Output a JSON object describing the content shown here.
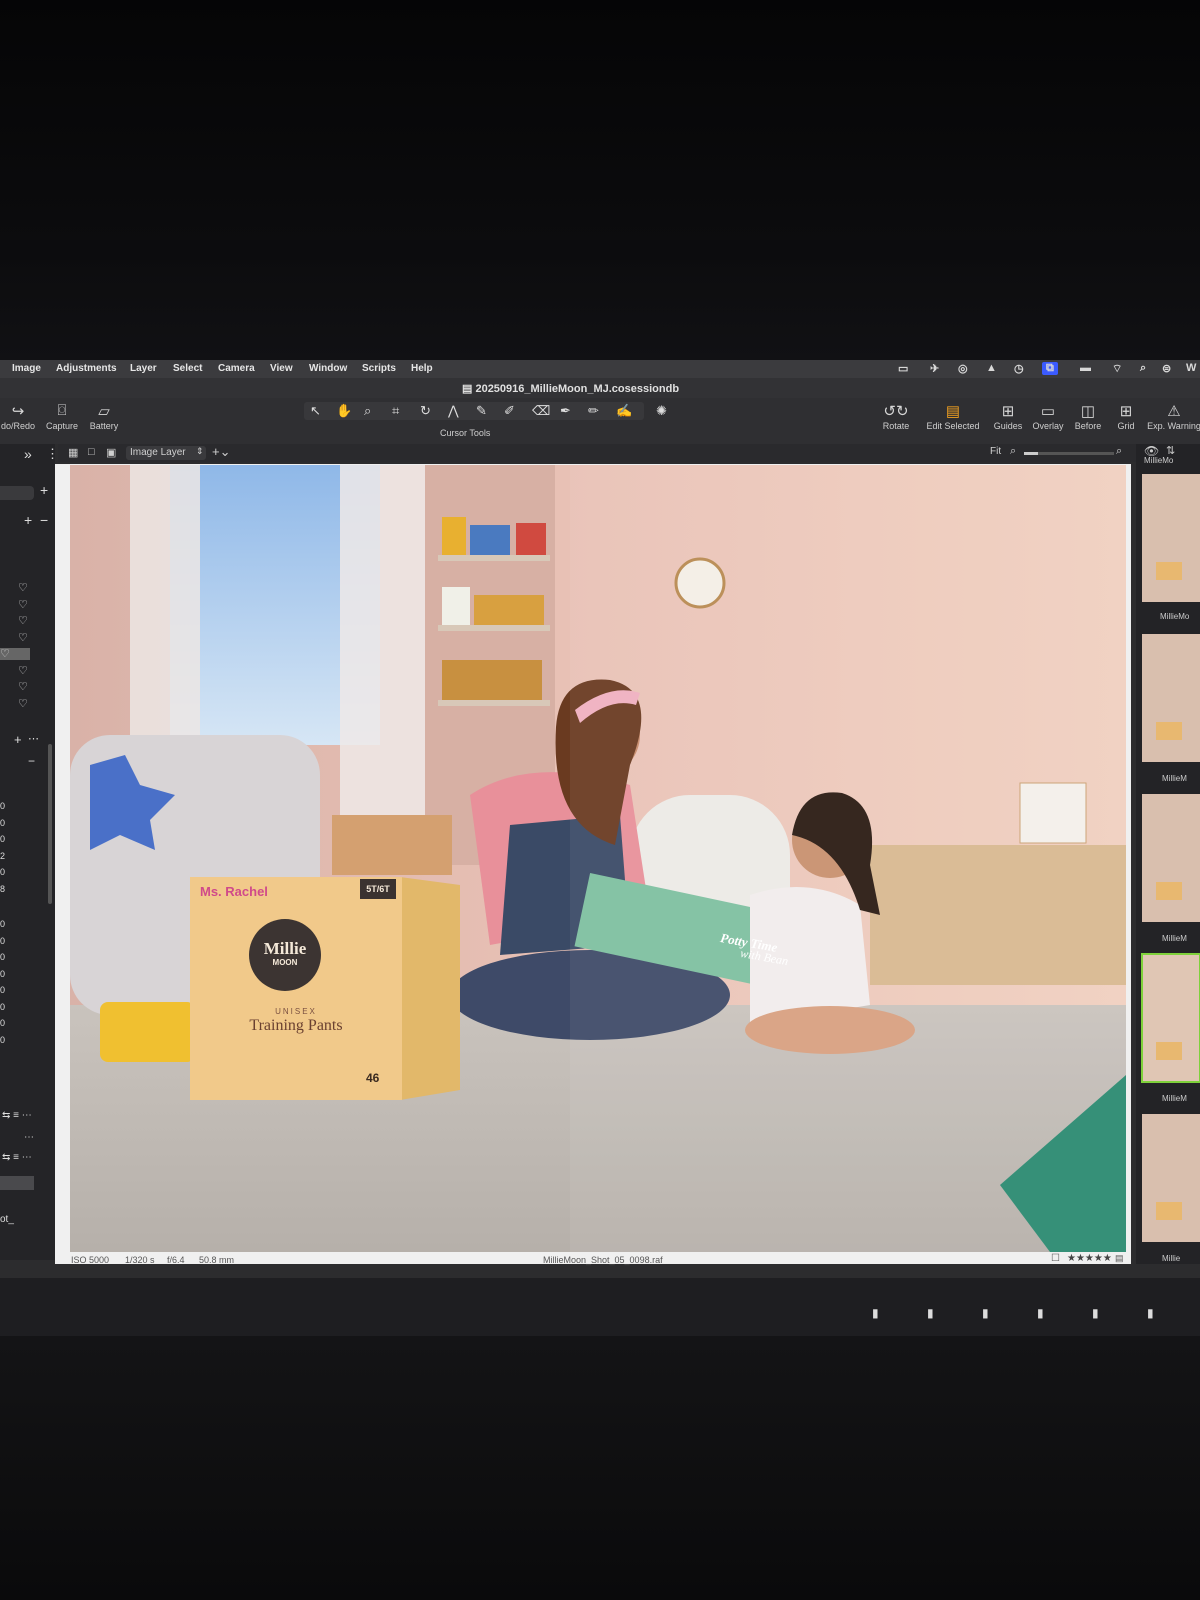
{
  "menubar": {
    "items": [
      "Image",
      "Adjustments",
      "Layer",
      "Select",
      "Camera",
      "View",
      "Window",
      "Scripts",
      "Help"
    ],
    "right_partial": "W"
  },
  "window_title": "20250916_MillieMoon_MJ.cosessiondb",
  "toolbar": {
    "undo_redo_label": "do/Redo",
    "capture_label": "Capture",
    "battery_label": "Battery",
    "cursor_tools_label": "Cursor Tools",
    "rotate_label": "Rotate",
    "edit_selected_label": "Edit Selected",
    "guides_label": "Guides",
    "overlay_label": "Overlay",
    "before_label": "Before",
    "grid_label": "Grid",
    "exp_warning_label": "Exp. Warning"
  },
  "viewer": {
    "layer_select": "Image Layer",
    "zoom_label": "Fit"
  },
  "left_panel": {
    "values": [
      "0",
      "0",
      "0",
      "2",
      "0",
      "8",
      "0",
      "0",
      "0",
      "0",
      "0",
      "0",
      "0",
      "0"
    ],
    "footer": "ot_"
  },
  "right_panel": {
    "header": "MillieMo",
    "thumbnails": [
      "MillieMo",
      "MillieM",
      "MillieM",
      "MillieM",
      "Millie"
    ]
  },
  "photo": {
    "box_brand": "Ms. Rachel",
    "box_logo_line1": "Millie",
    "box_logo_line2": "MOON",
    "box_type": "UNISEX",
    "box_product": "Training Pants",
    "box_size": "5T/6T",
    "box_count": "46",
    "book_title_line1": "Potty Time",
    "book_title_line2": "with Bean"
  },
  "infobar": {
    "iso": "ISO 5000",
    "shutter": "1/320 s",
    "aperture": "f/6.4",
    "focal": "50.8 mm",
    "filename": "MillieMoon_Shot_05_0098.raf",
    "rating": "★★★★★"
  },
  "colors": {
    "accent_green": "#7fd13b",
    "menubar_bg": "#3b3b3e",
    "wall_pink": "#e8b5a8"
  }
}
